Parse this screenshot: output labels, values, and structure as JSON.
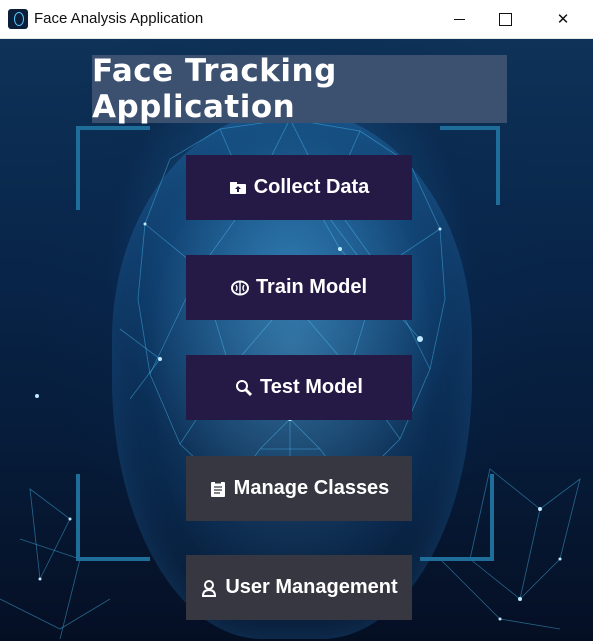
{
  "window": {
    "title": "Face Analysis Application",
    "icon": "face-scan-icon",
    "controls": {
      "minimize": "minimize-icon",
      "maximize": "maximize-icon",
      "close": "close-icon"
    }
  },
  "main": {
    "heading": "Face Tracking Application",
    "buttons": [
      {
        "label": "Collect Data",
        "icon": "folder-upload-icon"
      },
      {
        "label": "Train Model",
        "icon": "brain-icon"
      },
      {
        "label": "Test Model",
        "icon": "magnifier-icon"
      },
      {
        "label": "Manage Classes",
        "icon": "clipboard-icon"
      },
      {
        "label": "User Management",
        "icon": "user-icon"
      }
    ]
  },
  "colors": {
    "heading_bg": "#3c5070",
    "button_primary": "#241a45",
    "button_secondary": "#373741",
    "accent": "#3fb8f0"
  }
}
